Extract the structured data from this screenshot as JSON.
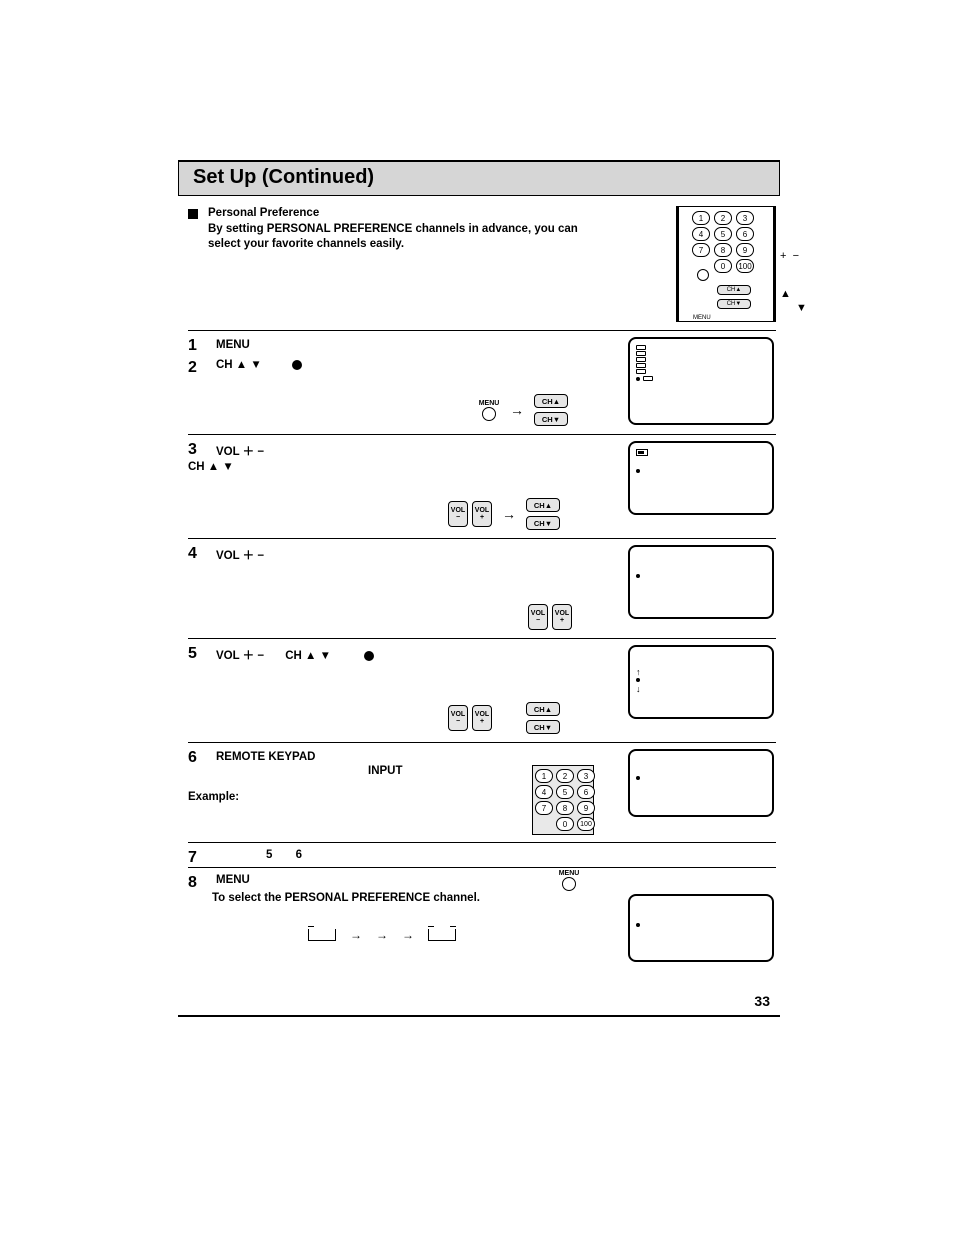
{
  "title": "Set Up (Continued)",
  "intro": {
    "heading": "Personal Preference",
    "body": "By setting PERSONAL PREFERENCE channels in advance, you can select your favorite channels easily."
  },
  "remote_side": {
    "plus": "+",
    "minus": "−",
    "up": "▲",
    "down": "▼",
    "menu_label": "MENU",
    "ch_up": "CH▲",
    "ch_down": "CH▼",
    "keypad": [
      "1",
      "2",
      "3",
      "4",
      "5",
      "6",
      "7",
      "8",
      "9",
      "",
      "0",
      "100"
    ]
  },
  "buttons": {
    "menu": "MENU",
    "ch_up": "CH▲",
    "ch_down": "CH▼",
    "vol_label": "VOL",
    "vol_minus": "−",
    "vol_plus": "+",
    "arrow": "→"
  },
  "steps": {
    "s1": {
      "num": "1",
      "text": "MENU"
    },
    "s2": {
      "num": "2",
      "text": "CH ▲ ▼"
    },
    "s3": {
      "num": "3",
      "text": "VOL ＋ −",
      "sub": "CH ▲ ▼"
    },
    "s4": {
      "num": "4",
      "text": "VOL ＋ −"
    },
    "s5": {
      "num": "5",
      "text": "VOL ＋ −",
      "extra": "CH ▲ ▼"
    },
    "s6": {
      "num": "6",
      "text": "REMOTE KEYPAD",
      "sub": "INPUT",
      "example": "Example:"
    },
    "s7": {
      "num": "7",
      "ref_a": "5",
      "ref_b": "6"
    },
    "s8": {
      "num": "8",
      "text": "MENU"
    }
  },
  "keypad_big": [
    "1",
    "2",
    "3",
    "4",
    "5",
    "6",
    "7",
    "8",
    "9",
    "",
    "0",
    "100"
  ],
  "footer": {
    "select_text": "To select the PERSONAL PREFERENCE channel."
  },
  "page_number": "33"
}
